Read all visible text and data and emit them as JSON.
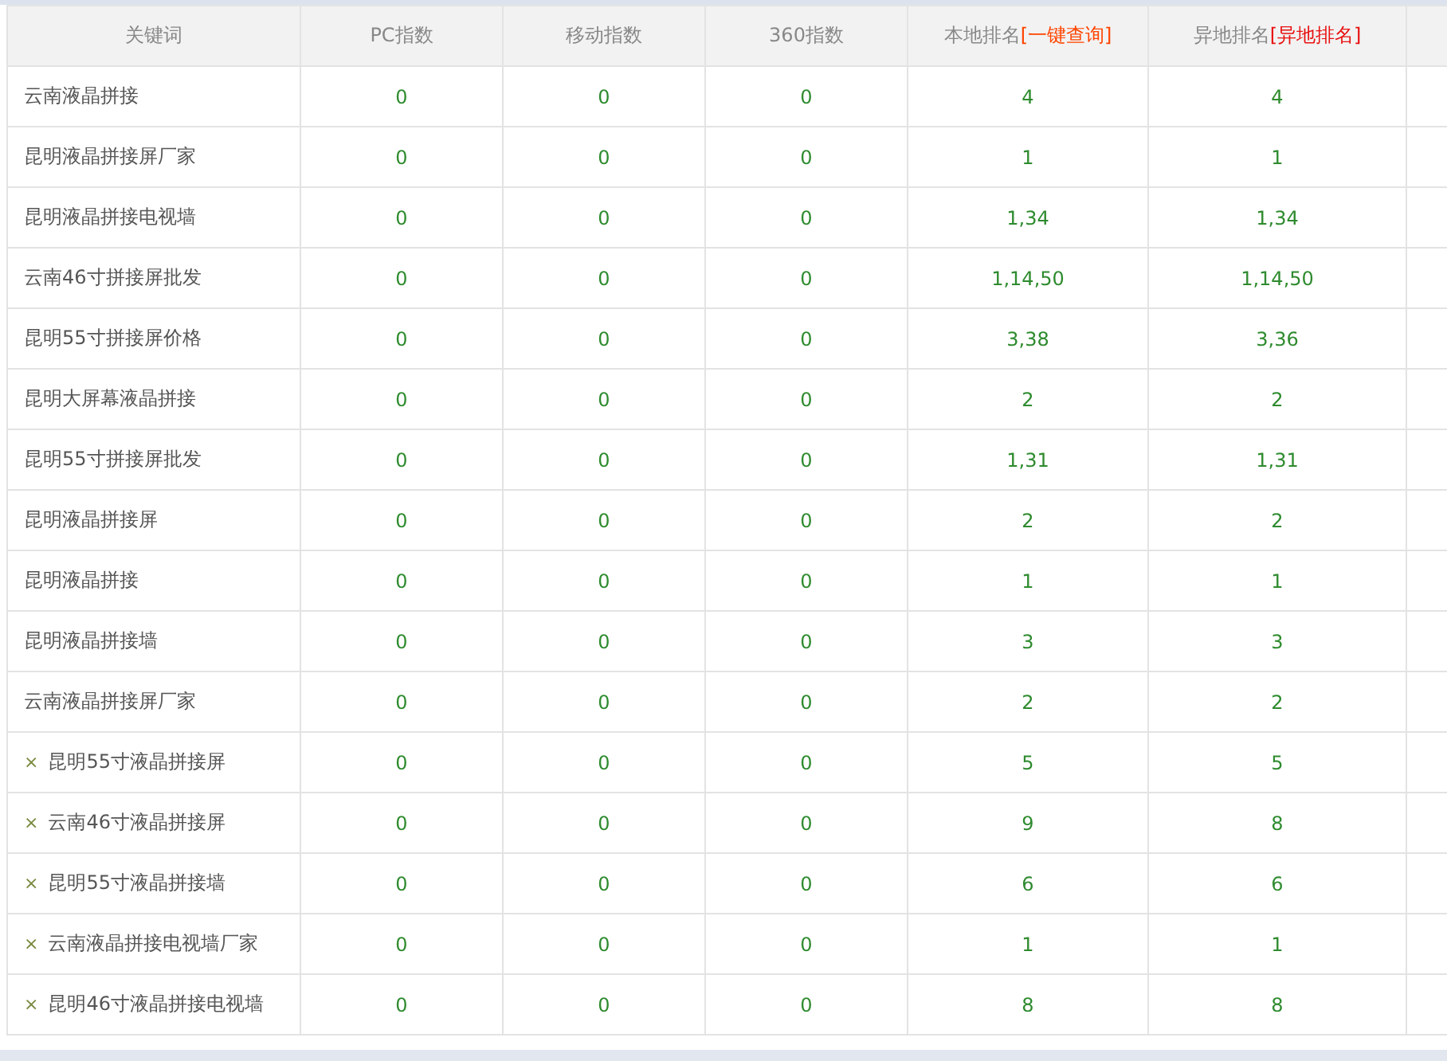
{
  "table": {
    "columns": [
      {
        "label": "关键词"
      },
      {
        "label": "PC指数"
      },
      {
        "label": "移动指数"
      },
      {
        "label": "360指数"
      },
      {
        "label": "本地排名",
        "link": "[一键查询]"
      },
      {
        "label": "异地排名",
        "link": "[异地排名]"
      }
    ],
    "rows": [
      {
        "keyword": "云南液晶拼接",
        "pc": "0",
        "mobile": "0",
        "so360": "0",
        "local": "4",
        "remote": "4"
      },
      {
        "keyword": "昆明液晶拼接屏厂家",
        "pc": "0",
        "mobile": "0",
        "so360": "0",
        "local": "1",
        "remote": "1"
      },
      {
        "keyword": "昆明液晶拼接电视墙",
        "pc": "0",
        "mobile": "0",
        "so360": "0",
        "local": "1,34",
        "remote": "1,34"
      },
      {
        "keyword": "云南46寸拼接屏批发",
        "pc": "0",
        "mobile": "0",
        "so360": "0",
        "local": "1,14,50",
        "remote": "1,14,50"
      },
      {
        "keyword": "昆明55寸拼接屏价格",
        "pc": "0",
        "mobile": "0",
        "so360": "0",
        "local": "3,38",
        "remote": "3,36"
      },
      {
        "keyword": "昆明大屏幕液晶拼接",
        "pc": "0",
        "mobile": "0",
        "so360": "0",
        "local": "2",
        "remote": "2"
      },
      {
        "keyword": "昆明55寸拼接屏批发",
        "pc": "0",
        "mobile": "0",
        "so360": "0",
        "local": "1,31",
        "remote": "1,31"
      },
      {
        "keyword": "昆明液晶拼接屏",
        "pc": "0",
        "mobile": "0",
        "so360": "0",
        "local": "2",
        "remote": "2"
      },
      {
        "keyword": "昆明液晶拼接",
        "pc": "0",
        "mobile": "0",
        "so360": "0",
        "local": "1",
        "remote": "1"
      },
      {
        "keyword": "昆明液晶拼接墙",
        "pc": "0",
        "mobile": "0",
        "so360": "0",
        "local": "3",
        "remote": "3"
      },
      {
        "keyword": "云南液晶拼接屏厂家",
        "pc": "0",
        "mobile": "0",
        "so360": "0",
        "local": "2",
        "remote": "2"
      },
      {
        "remove": "×",
        "keyword": "昆明55寸液晶拼接屏",
        "pc": "0",
        "mobile": "0",
        "so360": "0",
        "local": "5",
        "remote": "5"
      },
      {
        "remove": "×",
        "keyword": "云南46寸液晶拼接屏",
        "pc": "0",
        "mobile": "0",
        "so360": "0",
        "local": "9",
        "remote": "8"
      },
      {
        "remove": "×",
        "keyword": "昆明55寸液晶拼接墙",
        "pc": "0",
        "mobile": "0",
        "so360": "0",
        "local": "6",
        "remote": "6"
      },
      {
        "remove": "×",
        "keyword": "云南液晶拼接电视墙厂家",
        "pc": "0",
        "mobile": "0",
        "so360": "0",
        "local": "1",
        "remote": "1"
      },
      {
        "remove": "×",
        "keyword": "昆明46寸液晶拼接电视墙",
        "pc": "0",
        "mobile": "0",
        "so360": "0",
        "local": "8",
        "remote": "8"
      }
    ]
  }
}
